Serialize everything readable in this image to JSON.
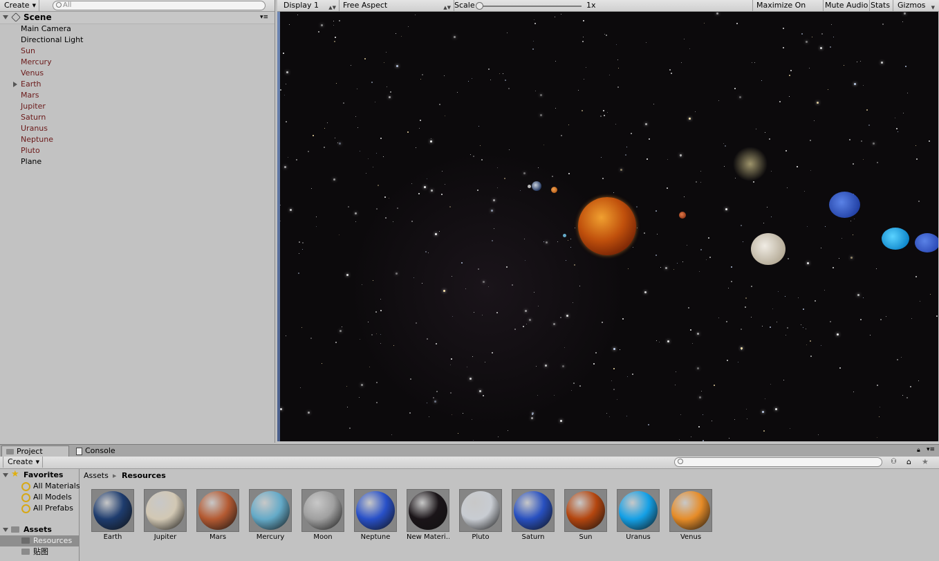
{
  "hierarchy": {
    "create_label": "Create",
    "search_placeholder": "All",
    "scene_name": "Scene",
    "items": [
      "Main Camera",
      "Directional Light",
      "Sun",
      "Mercury",
      "Venus",
      "Earth",
      "Mars",
      "Jupiter",
      "Saturn",
      "Uranus",
      "Neptune",
      "Pluto",
      "Plane"
    ]
  },
  "game": {
    "display": "Display 1",
    "aspect": "Free Aspect",
    "scale_label": "Scale",
    "scale_value": "1x",
    "maximize": "Maximize On Play",
    "mute": "Mute Audio",
    "stats": "Stats",
    "gizmos": "Gizmos"
  },
  "tabs": {
    "project": "Project",
    "console": "Console"
  },
  "project": {
    "create_label": "Create",
    "favorites_label": "Favorites",
    "favorites": [
      "All Materials",
      "All Models",
      "All Prefabs"
    ],
    "assets_label": "Assets",
    "folders": [
      "Resources",
      "贴图"
    ],
    "breadcrumb": [
      "Assets",
      "Resources"
    ],
    "assets": [
      {
        "name": "Earth",
        "color": "#1e3c6e"
      },
      {
        "name": "Jupiter",
        "color": "#d2c8b4"
      },
      {
        "name": "Mars",
        "color": "#b45a32"
      },
      {
        "name": "Mercury",
        "color": "#64aac8"
      },
      {
        "name": "Moon",
        "color": "#a0a0a0"
      },
      {
        "name": "Neptune",
        "color": "#2850c8"
      },
      {
        "name": "New Materi…",
        "color": "#1a1418"
      },
      {
        "name": "Pluto",
        "color": "#c8ccd2"
      },
      {
        "name": "Saturn",
        "color": "#2850c0"
      },
      {
        "name": "Sun",
        "color": "#b4460f"
      },
      {
        "name": "Uranus",
        "color": "#14a0e6"
      },
      {
        "name": "Venus",
        "color": "#e68c28"
      }
    ]
  }
}
